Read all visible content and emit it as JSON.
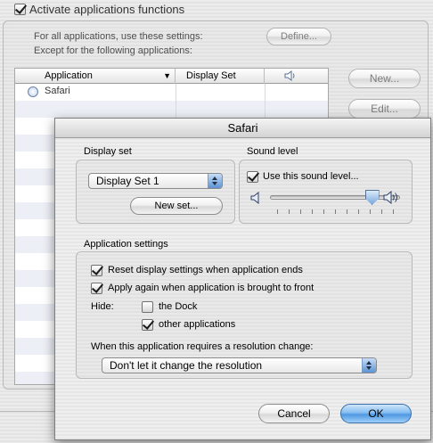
{
  "background": {
    "activate_label": "Activate applications functions",
    "activate_checked": true,
    "all_apps_text": "For all applications, use these settings:",
    "except_text": "Except for the following applications:",
    "define_button": "Define...",
    "new_button": "New...",
    "edit_button": "Edit...",
    "table": {
      "col_application": "Application",
      "col_display_set": "Display Set",
      "rows": [
        {
          "application": "Safari",
          "display_set": ""
        }
      ]
    }
  },
  "sheet": {
    "title": "Safari",
    "display_set": {
      "title": "Display set",
      "selected": "Display Set 1",
      "new_set_button": "New set..."
    },
    "sound_level": {
      "title": "Sound level",
      "use_label": "Use this sound level...",
      "use_checked": true,
      "level": 0.82
    },
    "app_settings": {
      "title": "Application settings",
      "reset_label": "Reset display settings when application ends",
      "reset_checked": true,
      "apply_label": "Apply again when application is brought to front",
      "apply_checked": true,
      "hide_label": "Hide:",
      "dock_label": "the Dock",
      "dock_checked": false,
      "other_label": "other applications",
      "other_checked": true,
      "resolution_label": "When this application requires a resolution change:",
      "resolution_selected": "Don't let it change the resolution"
    },
    "cancel_button": "Cancel",
    "ok_button": "OK"
  },
  "colors": {
    "accent": "#4f98e2",
    "row_stripe": "#ecf0f6"
  }
}
